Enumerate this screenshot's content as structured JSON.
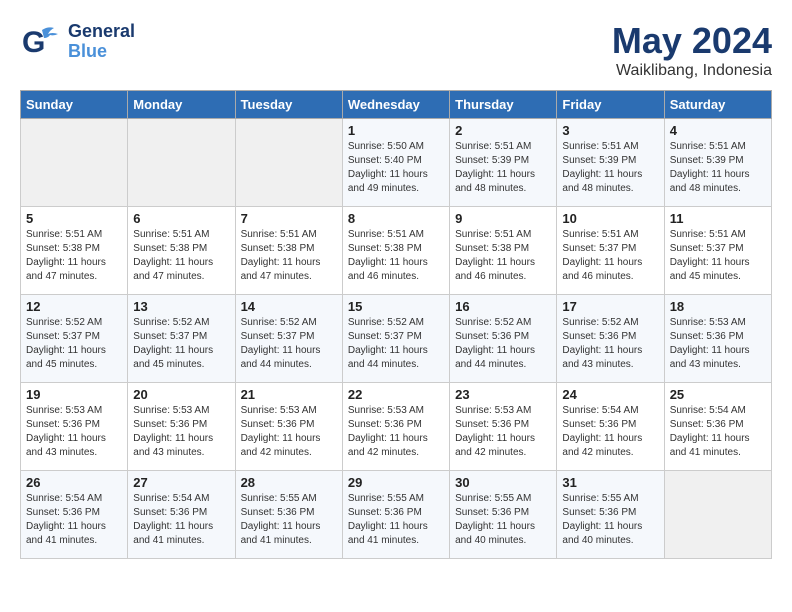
{
  "header": {
    "logo_line1": "General",
    "logo_line2": "Blue",
    "month": "May 2024",
    "location": "Waiklibang, Indonesia"
  },
  "weekdays": [
    "Sunday",
    "Monday",
    "Tuesday",
    "Wednesday",
    "Thursday",
    "Friday",
    "Saturday"
  ],
  "weeks": [
    [
      {
        "day": "",
        "info": ""
      },
      {
        "day": "",
        "info": ""
      },
      {
        "day": "",
        "info": ""
      },
      {
        "day": "1",
        "info": "Sunrise: 5:50 AM\nSunset: 5:40 PM\nDaylight: 11 hours\nand 49 minutes."
      },
      {
        "day": "2",
        "info": "Sunrise: 5:51 AM\nSunset: 5:39 PM\nDaylight: 11 hours\nand 48 minutes."
      },
      {
        "day": "3",
        "info": "Sunrise: 5:51 AM\nSunset: 5:39 PM\nDaylight: 11 hours\nand 48 minutes."
      },
      {
        "day": "4",
        "info": "Sunrise: 5:51 AM\nSunset: 5:39 PM\nDaylight: 11 hours\nand 48 minutes."
      }
    ],
    [
      {
        "day": "5",
        "info": "Sunrise: 5:51 AM\nSunset: 5:38 PM\nDaylight: 11 hours\nand 47 minutes."
      },
      {
        "day": "6",
        "info": "Sunrise: 5:51 AM\nSunset: 5:38 PM\nDaylight: 11 hours\nand 47 minutes."
      },
      {
        "day": "7",
        "info": "Sunrise: 5:51 AM\nSunset: 5:38 PM\nDaylight: 11 hours\nand 47 minutes."
      },
      {
        "day": "8",
        "info": "Sunrise: 5:51 AM\nSunset: 5:38 PM\nDaylight: 11 hours\nand 46 minutes."
      },
      {
        "day": "9",
        "info": "Sunrise: 5:51 AM\nSunset: 5:38 PM\nDaylight: 11 hours\nand 46 minutes."
      },
      {
        "day": "10",
        "info": "Sunrise: 5:51 AM\nSunset: 5:37 PM\nDaylight: 11 hours\nand 46 minutes."
      },
      {
        "day": "11",
        "info": "Sunrise: 5:51 AM\nSunset: 5:37 PM\nDaylight: 11 hours\nand 45 minutes."
      }
    ],
    [
      {
        "day": "12",
        "info": "Sunrise: 5:52 AM\nSunset: 5:37 PM\nDaylight: 11 hours\nand 45 minutes."
      },
      {
        "day": "13",
        "info": "Sunrise: 5:52 AM\nSunset: 5:37 PM\nDaylight: 11 hours\nand 45 minutes."
      },
      {
        "day": "14",
        "info": "Sunrise: 5:52 AM\nSunset: 5:37 PM\nDaylight: 11 hours\nand 44 minutes."
      },
      {
        "day": "15",
        "info": "Sunrise: 5:52 AM\nSunset: 5:37 PM\nDaylight: 11 hours\nand 44 minutes."
      },
      {
        "day": "16",
        "info": "Sunrise: 5:52 AM\nSunset: 5:36 PM\nDaylight: 11 hours\nand 44 minutes."
      },
      {
        "day": "17",
        "info": "Sunrise: 5:52 AM\nSunset: 5:36 PM\nDaylight: 11 hours\nand 43 minutes."
      },
      {
        "day": "18",
        "info": "Sunrise: 5:53 AM\nSunset: 5:36 PM\nDaylight: 11 hours\nand 43 minutes."
      }
    ],
    [
      {
        "day": "19",
        "info": "Sunrise: 5:53 AM\nSunset: 5:36 PM\nDaylight: 11 hours\nand 43 minutes."
      },
      {
        "day": "20",
        "info": "Sunrise: 5:53 AM\nSunset: 5:36 PM\nDaylight: 11 hours\nand 43 minutes."
      },
      {
        "day": "21",
        "info": "Sunrise: 5:53 AM\nSunset: 5:36 PM\nDaylight: 11 hours\nand 42 minutes."
      },
      {
        "day": "22",
        "info": "Sunrise: 5:53 AM\nSunset: 5:36 PM\nDaylight: 11 hours\nand 42 minutes."
      },
      {
        "day": "23",
        "info": "Sunrise: 5:53 AM\nSunset: 5:36 PM\nDaylight: 11 hours\nand 42 minutes."
      },
      {
        "day": "24",
        "info": "Sunrise: 5:54 AM\nSunset: 5:36 PM\nDaylight: 11 hours\nand 42 minutes."
      },
      {
        "day": "25",
        "info": "Sunrise: 5:54 AM\nSunset: 5:36 PM\nDaylight: 11 hours\nand 41 minutes."
      }
    ],
    [
      {
        "day": "26",
        "info": "Sunrise: 5:54 AM\nSunset: 5:36 PM\nDaylight: 11 hours\nand 41 minutes."
      },
      {
        "day": "27",
        "info": "Sunrise: 5:54 AM\nSunset: 5:36 PM\nDaylight: 11 hours\nand 41 minutes."
      },
      {
        "day": "28",
        "info": "Sunrise: 5:55 AM\nSunset: 5:36 PM\nDaylight: 11 hours\nand 41 minutes."
      },
      {
        "day": "29",
        "info": "Sunrise: 5:55 AM\nSunset: 5:36 PM\nDaylight: 11 hours\nand 41 minutes."
      },
      {
        "day": "30",
        "info": "Sunrise: 5:55 AM\nSunset: 5:36 PM\nDaylight: 11 hours\nand 40 minutes."
      },
      {
        "day": "31",
        "info": "Sunrise: 5:55 AM\nSunset: 5:36 PM\nDaylight: 11 hours\nand 40 minutes."
      },
      {
        "day": "",
        "info": ""
      }
    ]
  ]
}
